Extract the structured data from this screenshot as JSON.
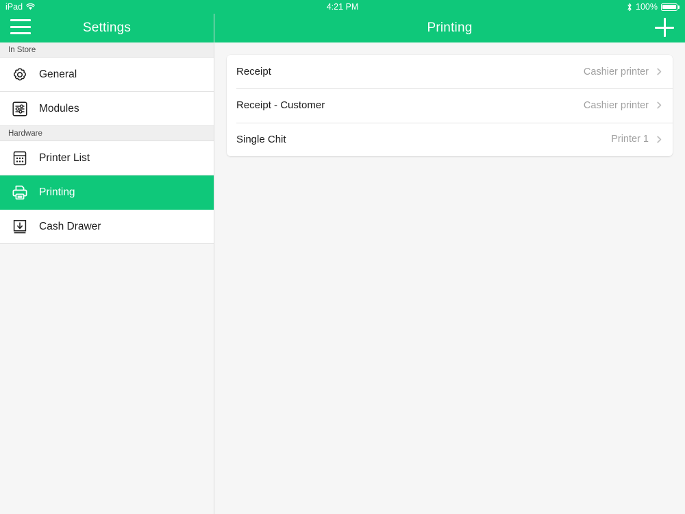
{
  "status_bar": {
    "device_label": "iPad",
    "wifi_icon": "wifi-icon",
    "time": "4:21 PM",
    "bluetooth_icon": "bluetooth-icon",
    "battery_percent": "100%",
    "battery_icon": "battery-full-icon"
  },
  "sidebar": {
    "menu_icon": "hamburger-menu-icon",
    "title": "Settings",
    "sections": [
      {
        "header": "In Store",
        "items": [
          {
            "label": "General",
            "icon": "gear-icon",
            "selected": false
          },
          {
            "label": "Modules",
            "icon": "sliders-icon",
            "selected": false
          }
        ]
      },
      {
        "header": "Hardware",
        "items": [
          {
            "label": "Printer List",
            "icon": "printer-list-icon",
            "selected": false
          },
          {
            "label": "Printing",
            "icon": "printer-icon",
            "selected": true
          },
          {
            "label": "Cash Drawer",
            "icon": "cash-drawer-icon",
            "selected": false
          }
        ]
      }
    ]
  },
  "main": {
    "title": "Printing",
    "add_icon": "plus-icon",
    "rows": [
      {
        "label": "Receipt",
        "value": "Cashier printer",
        "chevron": "chevron-right-icon"
      },
      {
        "label": "Receipt - Customer",
        "value": "Cashier printer",
        "chevron": "chevron-right-icon"
      },
      {
        "label": "Single Chit",
        "value": "Printer 1",
        "chevron": "chevron-right-icon"
      }
    ]
  },
  "colors": {
    "accent_green": "#0fc87a",
    "background": "#f6f6f6",
    "card": "#ffffff",
    "value_text": "#a0a0a0"
  }
}
